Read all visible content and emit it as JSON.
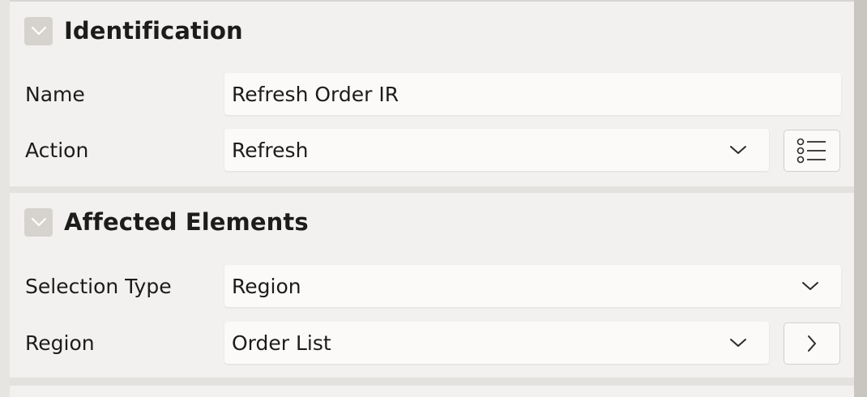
{
  "identification": {
    "title": "Identification",
    "name": {
      "label": "Name",
      "value": "Refresh Order IR"
    },
    "action": {
      "label": "Action",
      "value": "Refresh"
    }
  },
  "affected_elements": {
    "title": "Affected Elements",
    "selection_type": {
      "label": "Selection Type",
      "value": "Region"
    },
    "region": {
      "label": "Region",
      "value": "Order List"
    }
  },
  "icons": {
    "collapse": "chevron-down-icon",
    "select": "chevron-down-icon",
    "list": "list-icon",
    "navigate": "chevron-right-icon"
  },
  "colors": {
    "panel_bg": "#f2f1ef",
    "field_bg": "#fbfaf9",
    "text": "#1d1c1a",
    "collapse_button_bg": "#d6d3cf"
  }
}
